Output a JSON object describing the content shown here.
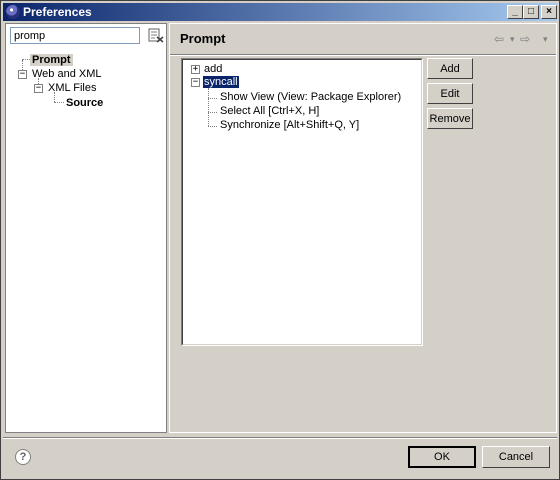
{
  "window": {
    "title": "Preferences",
    "minimize_glyph": "_",
    "maximize_glyph": "□",
    "close_glyph": "×"
  },
  "sidebar": {
    "filter": {
      "value": "promp",
      "placeholder": ""
    },
    "items": [
      {
        "label": "Prompt",
        "selected": true
      },
      {
        "label": "Web and XML",
        "expander": "−"
      },
      {
        "label": "XML Files",
        "expander": "−"
      },
      {
        "label": "Source",
        "bold": true
      }
    ]
  },
  "page": {
    "title": "Prompt",
    "nav_back": "⇦",
    "nav_menu": "▾",
    "nav_forward": "⇨",
    "nav_dropdown": "▾",
    "tree": [
      {
        "label": "add",
        "expander": "+"
      },
      {
        "label": "syncall",
        "expander": "−",
        "selected": true
      },
      {
        "label": "Show View (View: Package Explorer)"
      },
      {
        "label": "Select All [Ctrl+X, H]"
      },
      {
        "label": "Synchronize [Alt+Shift+Q, Y]"
      }
    ],
    "buttons": {
      "add": "Add",
      "edit": "Edit",
      "remove": "Remove"
    }
  },
  "footer": {
    "help_glyph": "?",
    "ok": "OK",
    "cancel": "Cancel"
  },
  "colors": {
    "titlebar_start": "#0a246a",
    "titlebar_end": "#a6caf0",
    "selection": "#0a246a",
    "dialog_bg": "#d4d0c8"
  }
}
